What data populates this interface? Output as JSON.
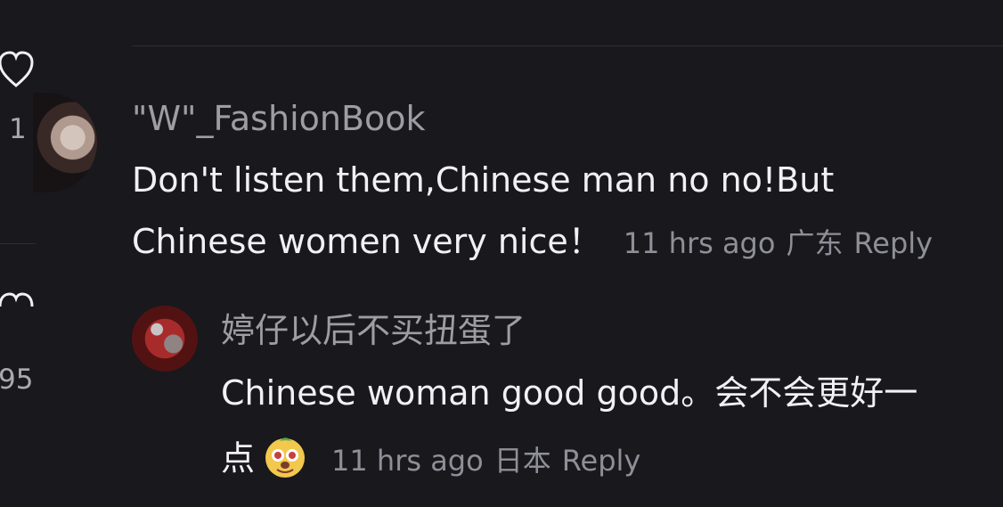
{
  "side": {
    "like_count_top": "1",
    "like_count_bottom": "95"
  },
  "comments": [
    {
      "username": "\"W\"_FashionBook",
      "line1": "Don't listen them,Chinese man no no!But",
      "line2": "Chinese women very nice！",
      "time": "11 hrs ago",
      "location": "广东",
      "reply_label": "Reply"
    },
    {
      "username": "婷仔以后不买扭蛋了",
      "line1": "Chinese woman good good。会不会更好一",
      "line2": "点",
      "time": "11 hrs ago",
      "location": "日本",
      "reply_label": "Reply",
      "emoji": "doge-emoji"
    }
  ],
  "colors": {
    "background": "#18181d",
    "primary_text": "#f1f1f4",
    "secondary_text": "#9d9da4",
    "meta_text": "#8f8f97"
  }
}
